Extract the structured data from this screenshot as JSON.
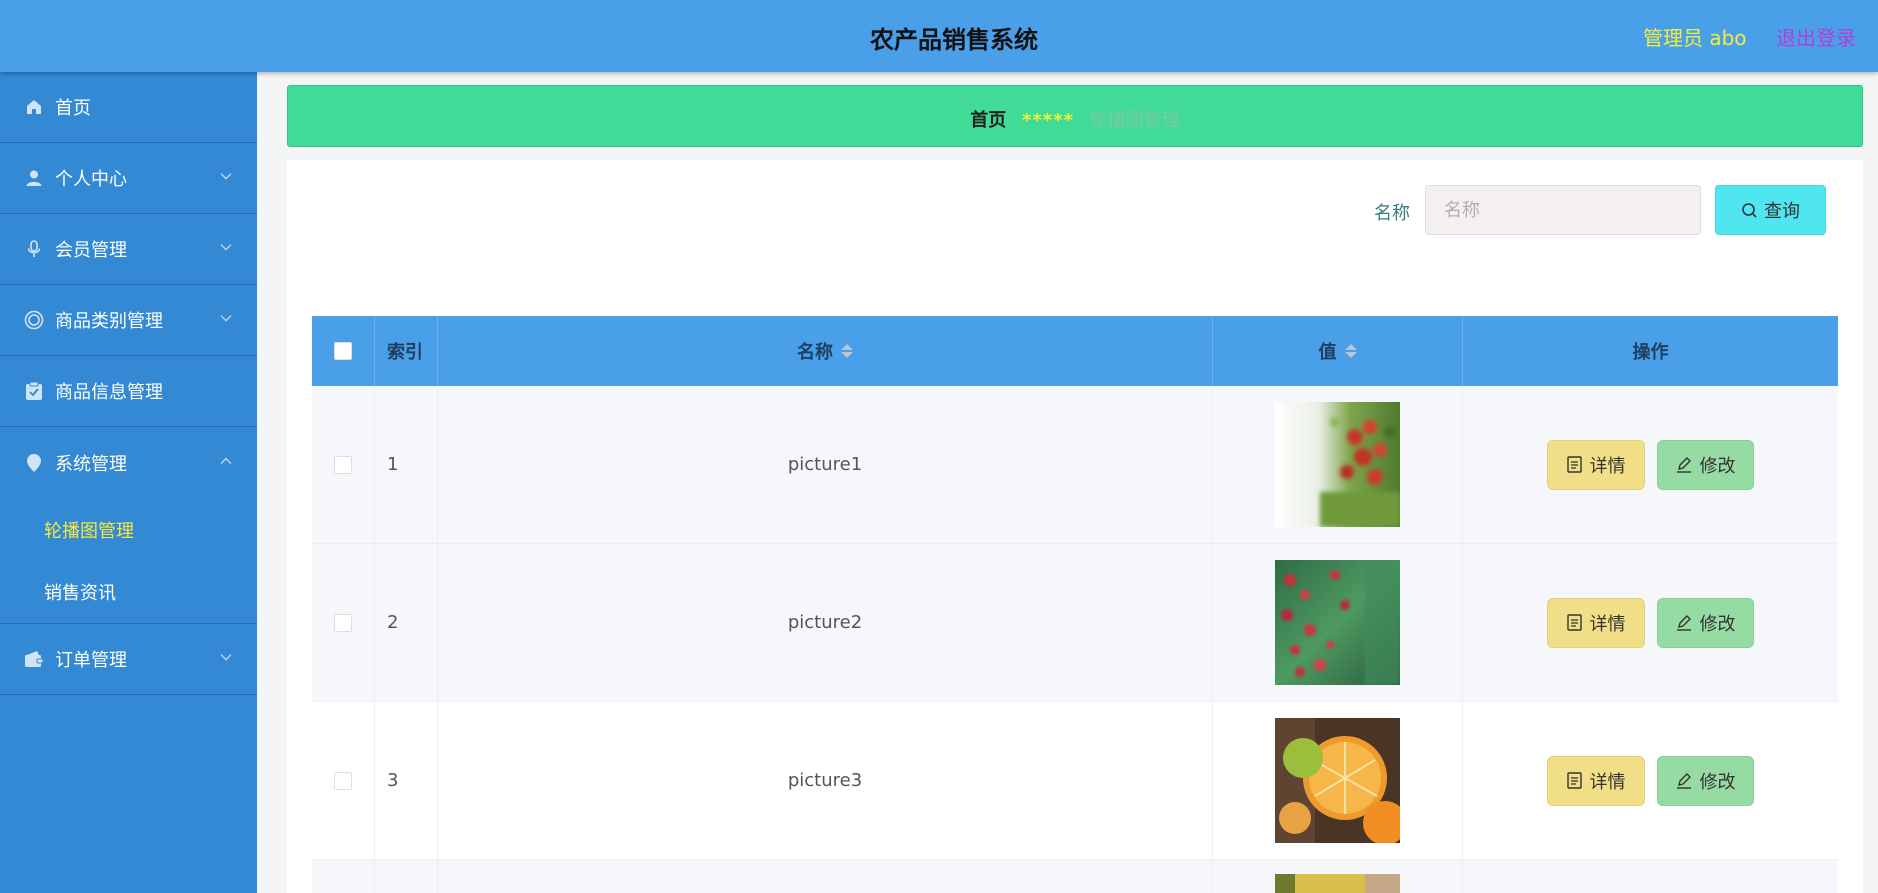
{
  "header": {
    "title": "农产品销售系统",
    "user_label": "管理员 abo",
    "logout": "退出登录"
  },
  "sidebar": {
    "items": [
      {
        "label": "首页",
        "icon": "home-icon"
      },
      {
        "label": "个人中心",
        "icon": "user-icon"
      },
      {
        "label": "会员管理",
        "icon": "microphone-icon"
      },
      {
        "label": "商品类别管理",
        "icon": "target-icon"
      },
      {
        "label": "商品信息管理",
        "icon": "clipboard-check-icon"
      },
      {
        "label": "系统管理",
        "icon": "location-pin-icon"
      },
      {
        "label": "订单管理",
        "icon": "wallet-icon"
      }
    ],
    "subitems": [
      {
        "label": "轮播图管理",
        "active": true
      },
      {
        "label": "销售资讯",
        "active": false
      }
    ]
  },
  "breadcrumb": {
    "home": "首页",
    "separator": "*****",
    "current": "轮播图管理"
  },
  "search": {
    "label": "名称",
    "placeholder": "名称",
    "button": "查询"
  },
  "table": {
    "columns": [
      "索引",
      "名称",
      "值",
      "操作"
    ],
    "rows": [
      {
        "index": "1",
        "name": "picture1",
        "image": "red-berries"
      },
      {
        "index": "2",
        "name": "picture2",
        "image": "green-red-berries"
      },
      {
        "index": "3",
        "name": "picture3",
        "image": "oranges"
      },
      {
        "index": "",
        "name": "",
        "image": "yellow-partial"
      }
    ],
    "actions": {
      "detail": "详情",
      "edit": "修改"
    }
  },
  "colors": {
    "topbar": "#4aa0e8",
    "sidebar": "#3389d3",
    "breadcrumb": "#41db98",
    "active_menu": "#f6ea3c",
    "logout": "#b23fd3",
    "detail_button": "#f0df86",
    "edit_button": "#97dba4",
    "query_button": "#4fe6ef"
  }
}
